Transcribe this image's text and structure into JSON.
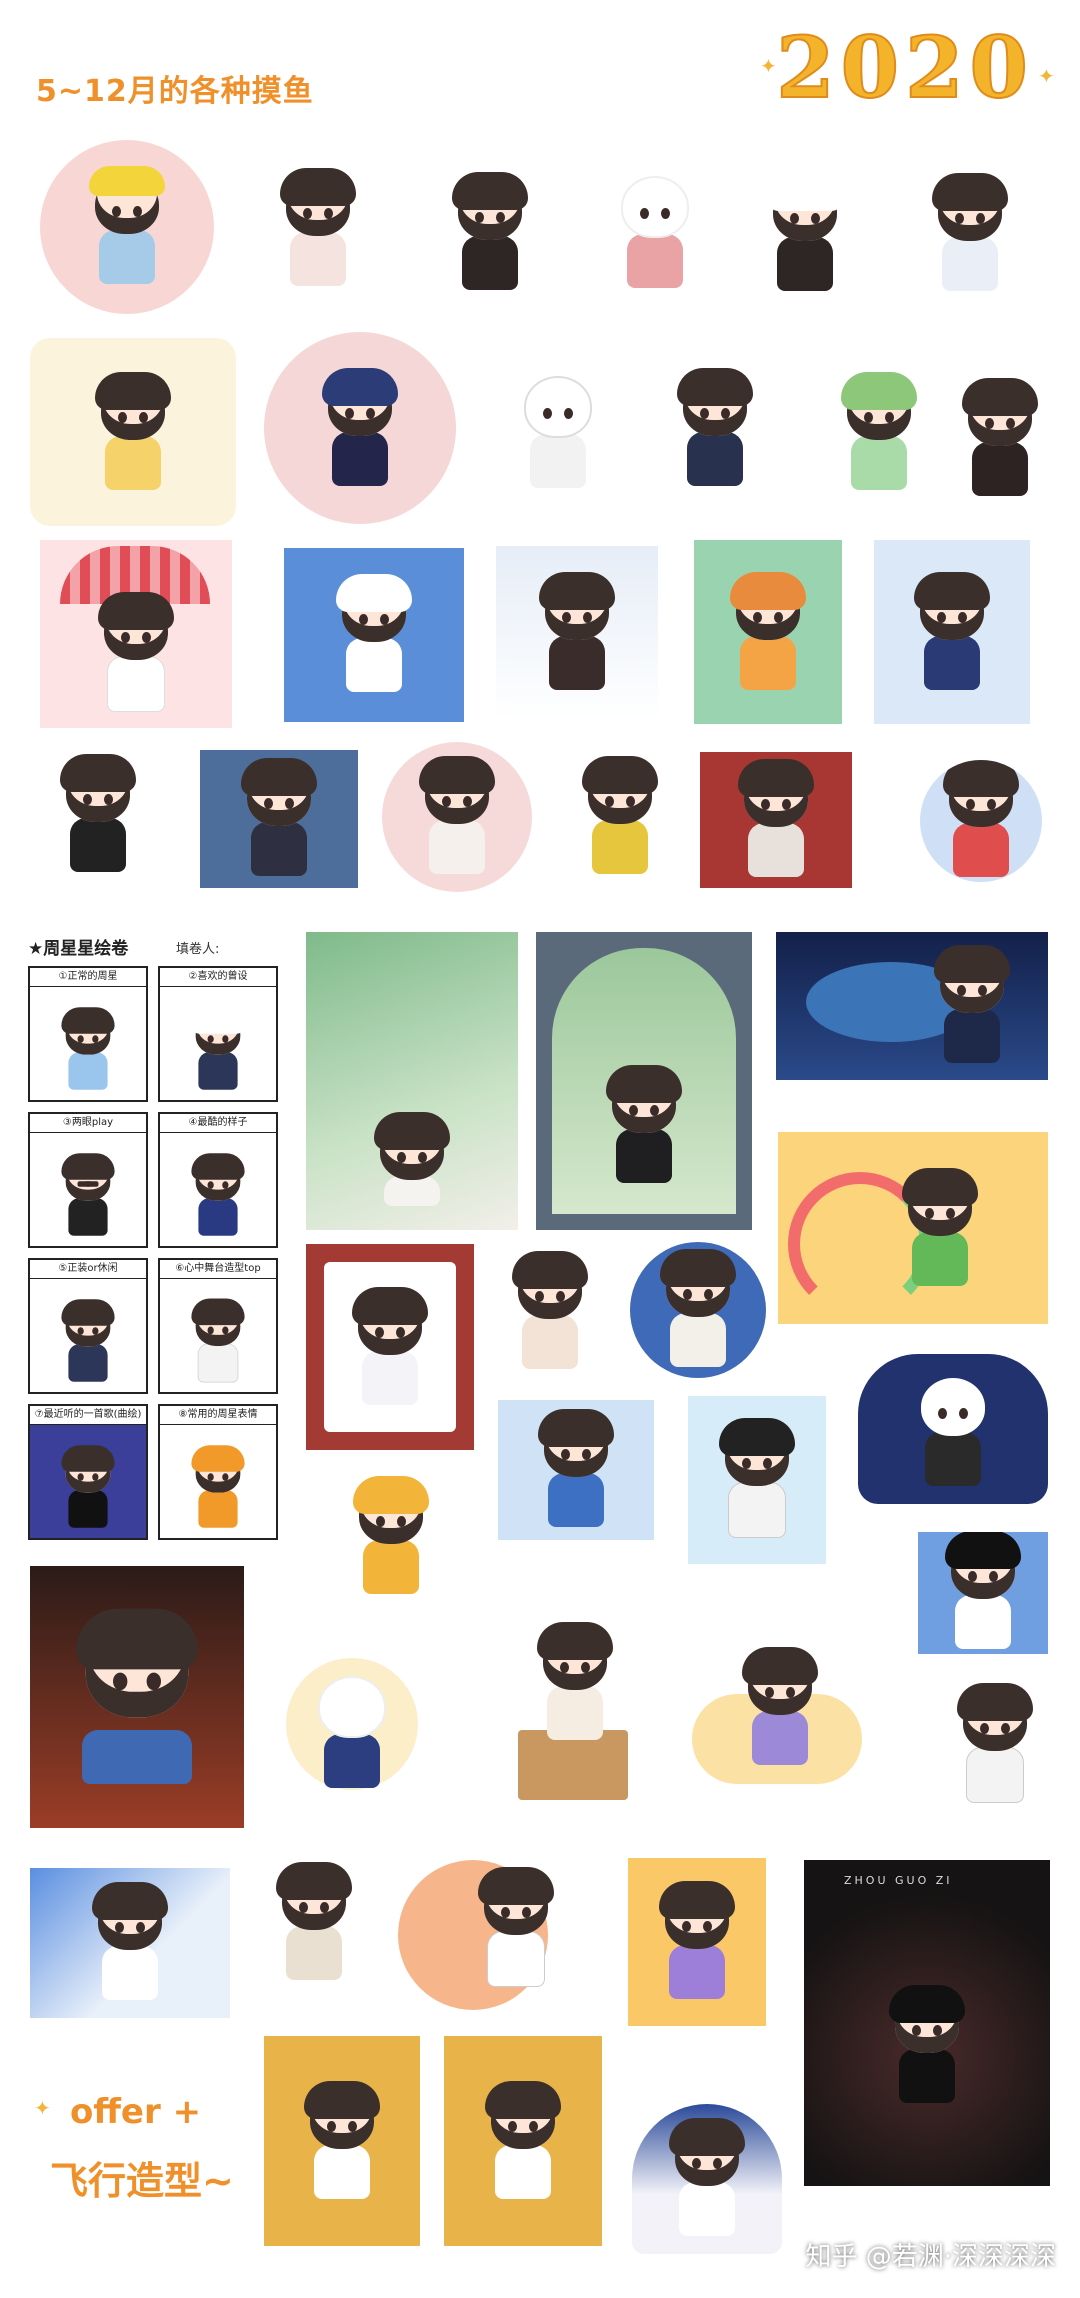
{
  "header": {
    "title": "5~12月的各种摸鱼",
    "year": "2020"
  },
  "worksheet": {
    "title": "周星星绘卷",
    "fill_label": "填卷人:",
    "cells": [
      {
        "label": "①正常的周星"
      },
      {
        "label": "②喜欢的曾设"
      },
      {
        "label": "③两眼play"
      },
      {
        "label": "④最酷的样子"
      },
      {
        "label": "⑤正装or休闲"
      },
      {
        "label": "⑥心中舞台造型top"
      },
      {
        "label": "⑦最近听的一首歌(曲绘)"
      },
      {
        "label": "⑧常用的周星表情"
      }
    ]
  },
  "annotations": {
    "offer": "offer +",
    "flight": "飞行造型~",
    "cg_text": "ZHOU GUO ZI",
    "credit": "知乎 @若渊·深深深深"
  },
  "colors": {
    "accent": "#f0902a",
    "year": "#f3b42c",
    "hair": "#3b2f2c",
    "skin": "#fde6d8"
  }
}
